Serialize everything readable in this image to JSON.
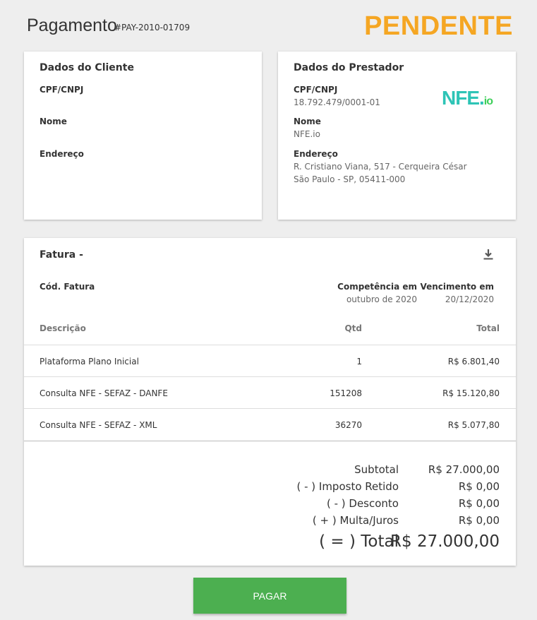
{
  "header": {
    "title": "Pagamento",
    "id": "#PAY-2010-01709",
    "status": "PENDENTE",
    "status_color": "#f5a623"
  },
  "client": {
    "title": "Dados do Cliente",
    "cpf_label": "CPF/CNPJ",
    "name_label": "Nome",
    "address_label": "Endereço"
  },
  "provider": {
    "title": "Dados do Prestador",
    "cpf_label": "CPF/CNPJ",
    "cpf_value": "18.792.479/0001-01",
    "name_label": "Nome",
    "name_value": "NFE.io",
    "address_label": "Endereço",
    "address_line1": "R. Cristiano Viana, 517 - Cerqueira César",
    "address_line2": "São Paulo - SP, 05411-000",
    "logo_main": "NFE.",
    "logo_io": "io"
  },
  "invoice": {
    "title": "Fatura -",
    "code_label": "Cód. Fatura",
    "competence_label": "Competência em",
    "competence_value": "outubro de 2020",
    "due_label": "Vencimento em",
    "due_value": "20/12/2020",
    "col_description": "Descrição",
    "col_qty": "Qtd",
    "col_total": "Total",
    "rows": [
      {
        "description": "Plataforma Plano Inicial",
        "qty": "1",
        "total": "R$ 6.801,40"
      },
      {
        "description": "Consulta NFE - SEFAZ - DANFE",
        "qty": "151208",
        "total": "R$ 15.120,80"
      },
      {
        "description": "Consulta NFE - SEFAZ - XML",
        "qty": "36270",
        "total": "R$ 5.077,80"
      }
    ],
    "subtotal_label": "Subtotal",
    "subtotal_value": "R$ 27.000,00",
    "tax_label": "( - ) Imposto Retido",
    "tax_value": "R$ 0,00",
    "discount_label": "( - ) Desconto",
    "discount_value": "R$ 0,00",
    "fine_label": "( + ) Multa/Juros",
    "fine_value": "R$ 0,00",
    "total_label": "( = ) Total",
    "total_value": "R$ 27.000,00"
  },
  "actions": {
    "pay_label": "PAGAR",
    "pay_color": "#4caf50"
  }
}
